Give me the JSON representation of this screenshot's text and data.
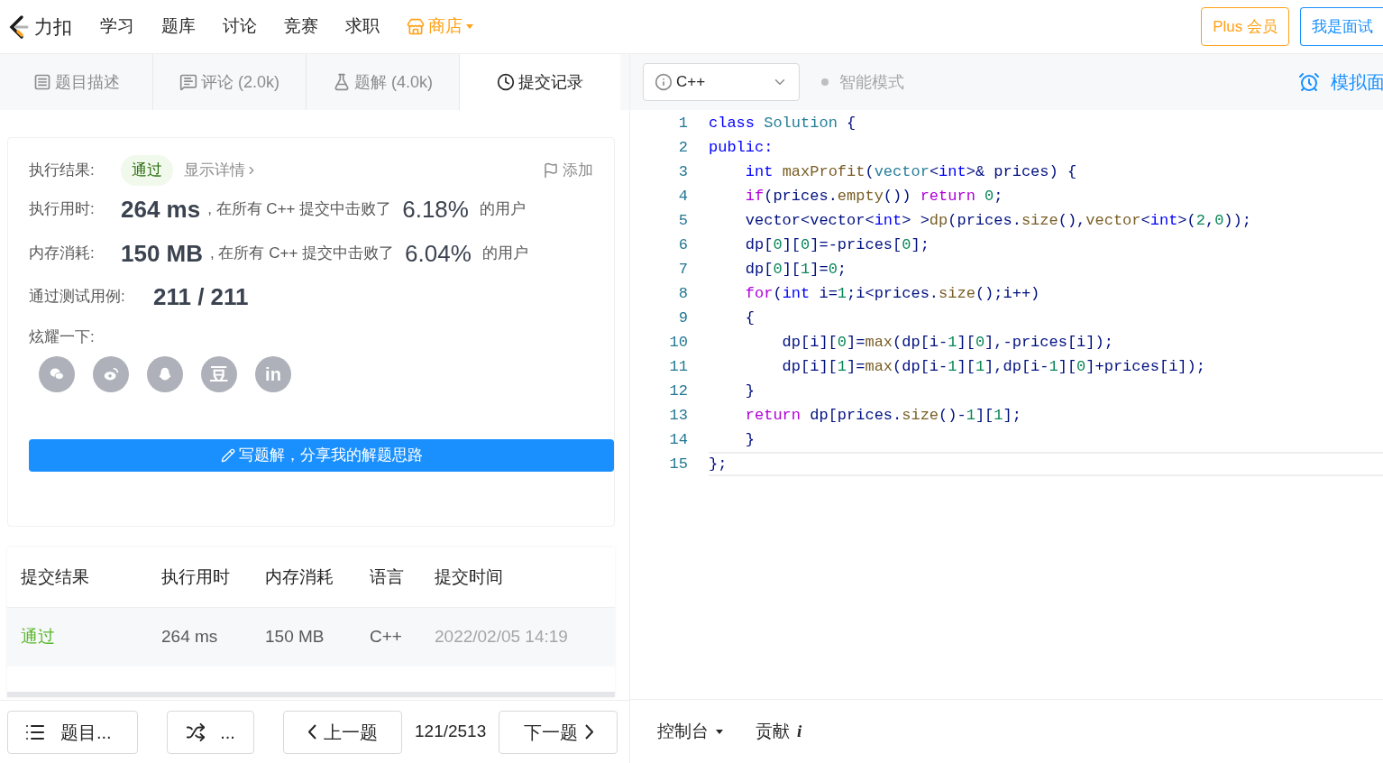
{
  "nav": {
    "logo_text": "力扣",
    "items": [
      {
        "label": "学习",
        "kind": "link"
      },
      {
        "label": "题库",
        "kind": "link"
      },
      {
        "label": "讨论",
        "kind": "link"
      },
      {
        "label": "竞赛",
        "kind": "link"
      },
      {
        "label": "求职",
        "kind": "link"
      },
      {
        "label": "商店",
        "kind": "store"
      }
    ],
    "buttons": [
      {
        "label": "Plus 会员",
        "kind": "plus"
      },
      {
        "label": "我是面试",
        "kind": "interviewer"
      }
    ]
  },
  "left_tabs": [
    {
      "label": "题目描述",
      "kind": "description",
      "selected": false
    },
    {
      "label": "评论 (2.0k)",
      "kind": "comments",
      "selected": false
    },
    {
      "label": "题解 (4.0k)",
      "kind": "solutions",
      "selected": false
    },
    {
      "label": "提交记录",
      "kind": "submissions",
      "selected": true
    }
  ],
  "result": {
    "label": "执行结果:",
    "status": "通过",
    "details": "显示详情",
    "flag": "添加",
    "stats": [
      {
        "label": "执行用时:",
        "value": "264 ms",
        "text": ", 在所有 C++ 提交中击败了",
        "percent": "6.18%",
        "suffix": "的用户"
      },
      {
        "label": "内存消耗:",
        "value": "150 MB",
        "text": ", 在所有 C++ 提交中击败了",
        "percent": "6.04%",
        "suffix": "的用户"
      }
    ],
    "cases_label": "通过测试用例:",
    "cases": "211 / 211",
    "share_label": "炫耀一下:",
    "share": [
      {
        "kind": "wechat"
      },
      {
        "kind": "weibo"
      },
      {
        "kind": "qq"
      },
      {
        "kind": "douban",
        "glyph": "豆"
      },
      {
        "kind": "linkedin",
        "glyph": "in"
      }
    ],
    "write_button": "写题解，分享我的解题思路"
  },
  "table": {
    "columns": [
      "提交结果",
      "执行用时",
      "内存消耗",
      "语言",
      "提交时间"
    ],
    "rows": [
      {
        "status": "通过",
        "time": "264 ms",
        "memory": "150 MB",
        "language": "C++",
        "submitted": "2022/02/05 14:19"
      }
    ]
  },
  "pager": {
    "list": "题目...",
    "random": "...",
    "prev": "上一题",
    "position": "121/2513",
    "next": "下一题"
  },
  "editor": {
    "language": "C++",
    "mode": "智能模式",
    "mock": "模拟面",
    "lines": [
      {
        "number": "1",
        "active": false,
        "tokens": [
          {
            "text": "class ",
            "kind": "keyword"
          },
          {
            "text": "Solution",
            "kind": "type"
          },
          {
            "text": " {",
            "kind": "plain"
          }
        ]
      },
      {
        "number": "2",
        "active": false,
        "tokens": [
          {
            "text": "public:",
            "kind": "keyword"
          }
        ]
      },
      {
        "number": "3",
        "active": false,
        "tokens": [
          {
            "text": "    int ",
            "kind": "keyword"
          },
          {
            "text": "maxProfit",
            "kind": "function"
          },
          {
            "text": "(",
            "kind": "plain"
          },
          {
            "text": "vector",
            "kind": "type"
          },
          {
            "text": "<",
            "kind": "plain"
          },
          {
            "text": "int",
            "kind": "keyword"
          },
          {
            "text": ">& prices) {",
            "kind": "plain"
          }
        ]
      },
      {
        "number": "4",
        "active": false,
        "tokens": [
          {
            "text": "    if",
            "kind": "control"
          },
          {
            "text": "(prices.",
            "kind": "plain"
          },
          {
            "text": "empty",
            "kind": "function"
          },
          {
            "text": "()) ",
            "kind": "plain"
          },
          {
            "text": "return ",
            "kind": "control"
          },
          {
            "text": "0",
            "kind": "number"
          },
          {
            "text": ";",
            "kind": "plain"
          }
        ]
      },
      {
        "number": "5",
        "active": false,
        "tokens": [
          {
            "text": "    vector<vector<",
            "kind": "plain"
          },
          {
            "text": "int",
            "kind": "keyword"
          },
          {
            "text": "> >",
            "kind": "plain"
          },
          {
            "text": "dp",
            "kind": "function"
          },
          {
            "text": "(prices.",
            "kind": "plain"
          },
          {
            "text": "size",
            "kind": "function"
          },
          {
            "text": "(),",
            "kind": "plain"
          },
          {
            "text": "vector",
            "kind": "function"
          },
          {
            "text": "<",
            "kind": "plain"
          },
          {
            "text": "int",
            "kind": "keyword"
          },
          {
            "text": ">(",
            "kind": "plain"
          },
          {
            "text": "2",
            "kind": "number"
          },
          {
            "text": ",",
            "kind": "plain"
          },
          {
            "text": "0",
            "kind": "number"
          },
          {
            "text": "));",
            "kind": "plain"
          }
        ]
      },
      {
        "number": "6",
        "active": false,
        "tokens": [
          {
            "text": "    dp[",
            "kind": "plain"
          },
          {
            "text": "0",
            "kind": "number"
          },
          {
            "text": "][",
            "kind": "plain"
          },
          {
            "text": "0",
            "kind": "number"
          },
          {
            "text": "]=-prices[",
            "kind": "plain"
          },
          {
            "text": "0",
            "kind": "number"
          },
          {
            "text": "];",
            "kind": "plain"
          }
        ]
      },
      {
        "number": "7",
        "active": false,
        "tokens": [
          {
            "text": "    dp[",
            "kind": "plain"
          },
          {
            "text": "0",
            "kind": "number"
          },
          {
            "text": "][",
            "kind": "plain"
          },
          {
            "text": "1",
            "kind": "number"
          },
          {
            "text": "]=",
            "kind": "plain"
          },
          {
            "text": "0",
            "kind": "number"
          },
          {
            "text": ";",
            "kind": "plain"
          }
        ]
      },
      {
        "number": "8",
        "active": false,
        "tokens": [
          {
            "text": "    for",
            "kind": "control"
          },
          {
            "text": "(",
            "kind": "plain"
          },
          {
            "text": "int",
            "kind": "keyword"
          },
          {
            "text": " i=",
            "kind": "plain"
          },
          {
            "text": "1",
            "kind": "number"
          },
          {
            "text": ";i<prices.",
            "kind": "plain"
          },
          {
            "text": "size",
            "kind": "function"
          },
          {
            "text": "();i++)",
            "kind": "plain"
          }
        ]
      },
      {
        "number": "9",
        "active": false,
        "tokens": [
          {
            "text": "    {",
            "kind": "plain"
          }
        ]
      },
      {
        "number": "10",
        "active": false,
        "tokens": [
          {
            "text": "        dp[i][",
            "kind": "plain"
          },
          {
            "text": "0",
            "kind": "number"
          },
          {
            "text": "]=",
            "kind": "plain"
          },
          {
            "text": "max",
            "kind": "function"
          },
          {
            "text": "(dp[i-",
            "kind": "plain"
          },
          {
            "text": "1",
            "kind": "number"
          },
          {
            "text": "][",
            "kind": "plain"
          },
          {
            "text": "0",
            "kind": "number"
          },
          {
            "text": "],-prices[i]);",
            "kind": "plain"
          }
        ]
      },
      {
        "number": "11",
        "active": false,
        "tokens": [
          {
            "text": "        dp[i][",
            "kind": "plain"
          },
          {
            "text": "1",
            "kind": "number"
          },
          {
            "text": "]=",
            "kind": "plain"
          },
          {
            "text": "max",
            "kind": "function"
          },
          {
            "text": "(dp[i-",
            "kind": "plain"
          },
          {
            "text": "1",
            "kind": "number"
          },
          {
            "text": "][",
            "kind": "plain"
          },
          {
            "text": "1",
            "kind": "number"
          },
          {
            "text": "],dp[i-",
            "kind": "plain"
          },
          {
            "text": "1",
            "kind": "number"
          },
          {
            "text": "][",
            "kind": "plain"
          },
          {
            "text": "0",
            "kind": "number"
          },
          {
            "text": "]+prices[i]);",
            "kind": "plain"
          }
        ]
      },
      {
        "number": "12",
        "active": false,
        "tokens": [
          {
            "text": "    }",
            "kind": "plain"
          }
        ]
      },
      {
        "number": "13",
        "active": false,
        "tokens": [
          {
            "text": "    return",
            "kind": "control"
          },
          {
            "text": " dp[prices.",
            "kind": "plain"
          },
          {
            "text": "size",
            "kind": "function"
          },
          {
            "text": "()-",
            "kind": "plain"
          },
          {
            "text": "1",
            "kind": "number"
          },
          {
            "text": "][",
            "kind": "plain"
          },
          {
            "text": "1",
            "kind": "number"
          },
          {
            "text": "];",
            "kind": "plain"
          }
        ]
      },
      {
        "number": "14",
        "active": false,
        "tokens": [
          {
            "text": "    }",
            "kind": "plain"
          }
        ]
      },
      {
        "number": "15",
        "active": true,
        "tokens": [
          {
            "text": "};",
            "kind": "plain"
          }
        ]
      }
    ]
  },
  "footer": {
    "console": "控制台",
    "contribute": "贡献",
    "contribute_mark": "i"
  }
}
